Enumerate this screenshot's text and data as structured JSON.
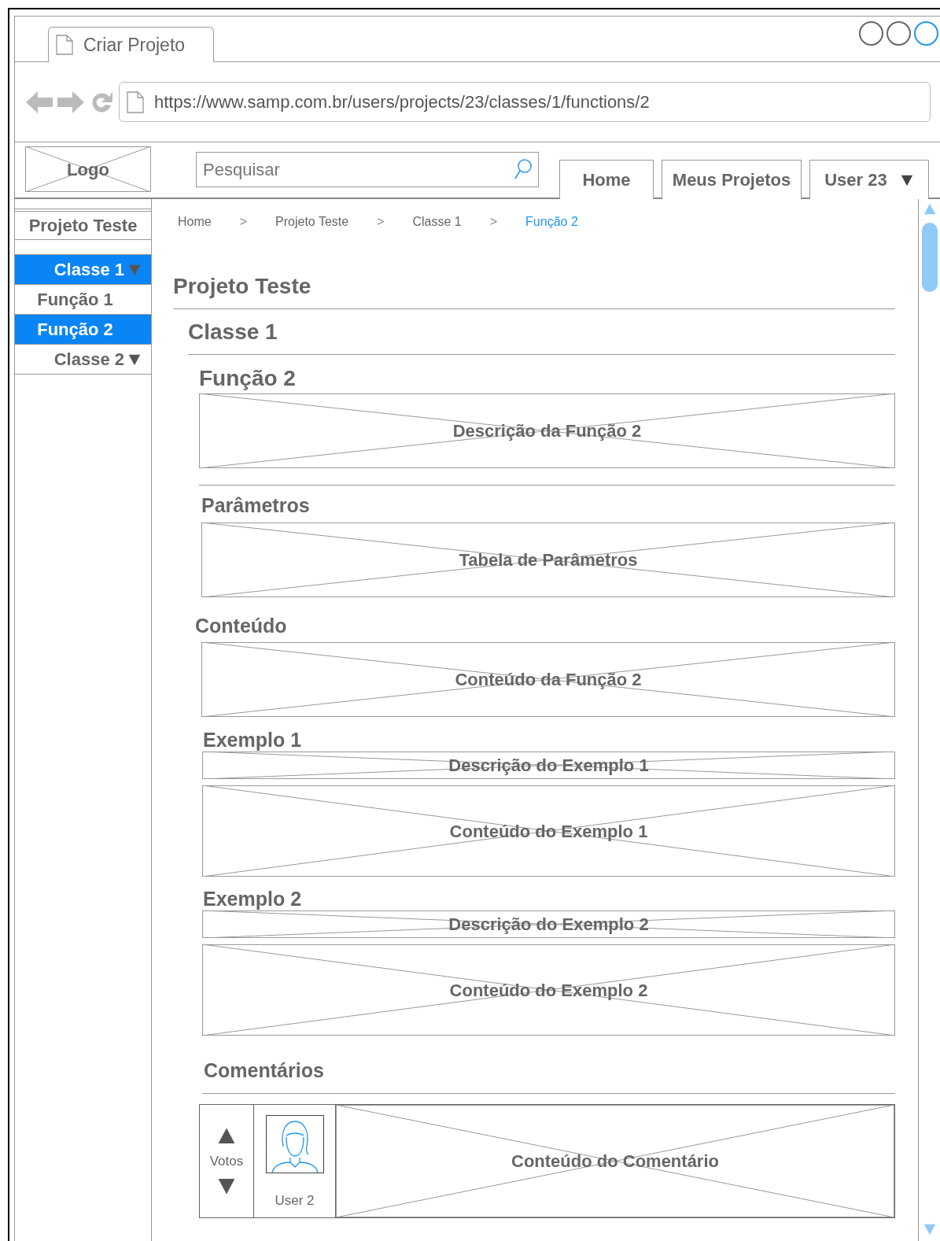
{
  "browser": {
    "tab_title": "Criar Projeto",
    "url": "https://www.samp.com.br/users/projects/23/classes/1/functions/2",
    "window_controls": [
      {
        "color": "#666666"
      },
      {
        "color": "#666666"
      },
      {
        "color": "#2196f3"
      }
    ]
  },
  "nav": {
    "logo": "Logo",
    "search": {
      "placeholder": "Pesquisar"
    },
    "menu": [
      {
        "label": "Home",
        "dropdown": false
      },
      {
        "label": "Meus Projetos",
        "dropdown": false
      },
      {
        "label": "User 23",
        "dropdown": true
      }
    ]
  },
  "sidebar": {
    "title": "Projeto Teste",
    "items": [
      {
        "kind": "class",
        "label": "Classe 1",
        "selected": true
      },
      {
        "kind": "function",
        "label": "Função 1",
        "selected": false
      },
      {
        "kind": "function",
        "label": "Função 2",
        "selected": true
      },
      {
        "kind": "class",
        "label": "Classe 2",
        "selected": false
      }
    ]
  },
  "breadcrumb": [
    {
      "kind": "link",
      "label": "Home"
    },
    {
      "kind": "separator",
      "label": ">"
    },
    {
      "kind": "link",
      "label": "Projeto Teste"
    },
    {
      "kind": "separator",
      "label": ">"
    },
    {
      "kind": "link",
      "label": "Classe 1"
    },
    {
      "kind": "separator",
      "label": ">"
    },
    {
      "kind": "current",
      "label": "Função 2"
    }
  ],
  "content": {
    "project_title": "Projeto Teste",
    "class_title": "Classe 1",
    "function_title": "Função 2",
    "description": "Descrição da Função 2",
    "parameters": {
      "title": "Parâmetros",
      "table": "Tabela de Parâmetros"
    },
    "body": {
      "title": "Conteúdo",
      "text": "Conteúdo da Função 2"
    },
    "examples": [
      {
        "title": "Exemplo 1",
        "description": "Descrição do Exemplo 1",
        "body": "Conteúdo do Exemplo 1"
      },
      {
        "title": "Exemplo 2",
        "description": "Descrição do Exemplo 2",
        "body": "Conteúdo do Exemplo 2"
      }
    ],
    "comments": {
      "title": "Comentários",
      "items": [
        {
          "votes_label": "Votos",
          "user": "User 2",
          "text": "Conteúdo do Comentário"
        }
      ]
    }
  }
}
